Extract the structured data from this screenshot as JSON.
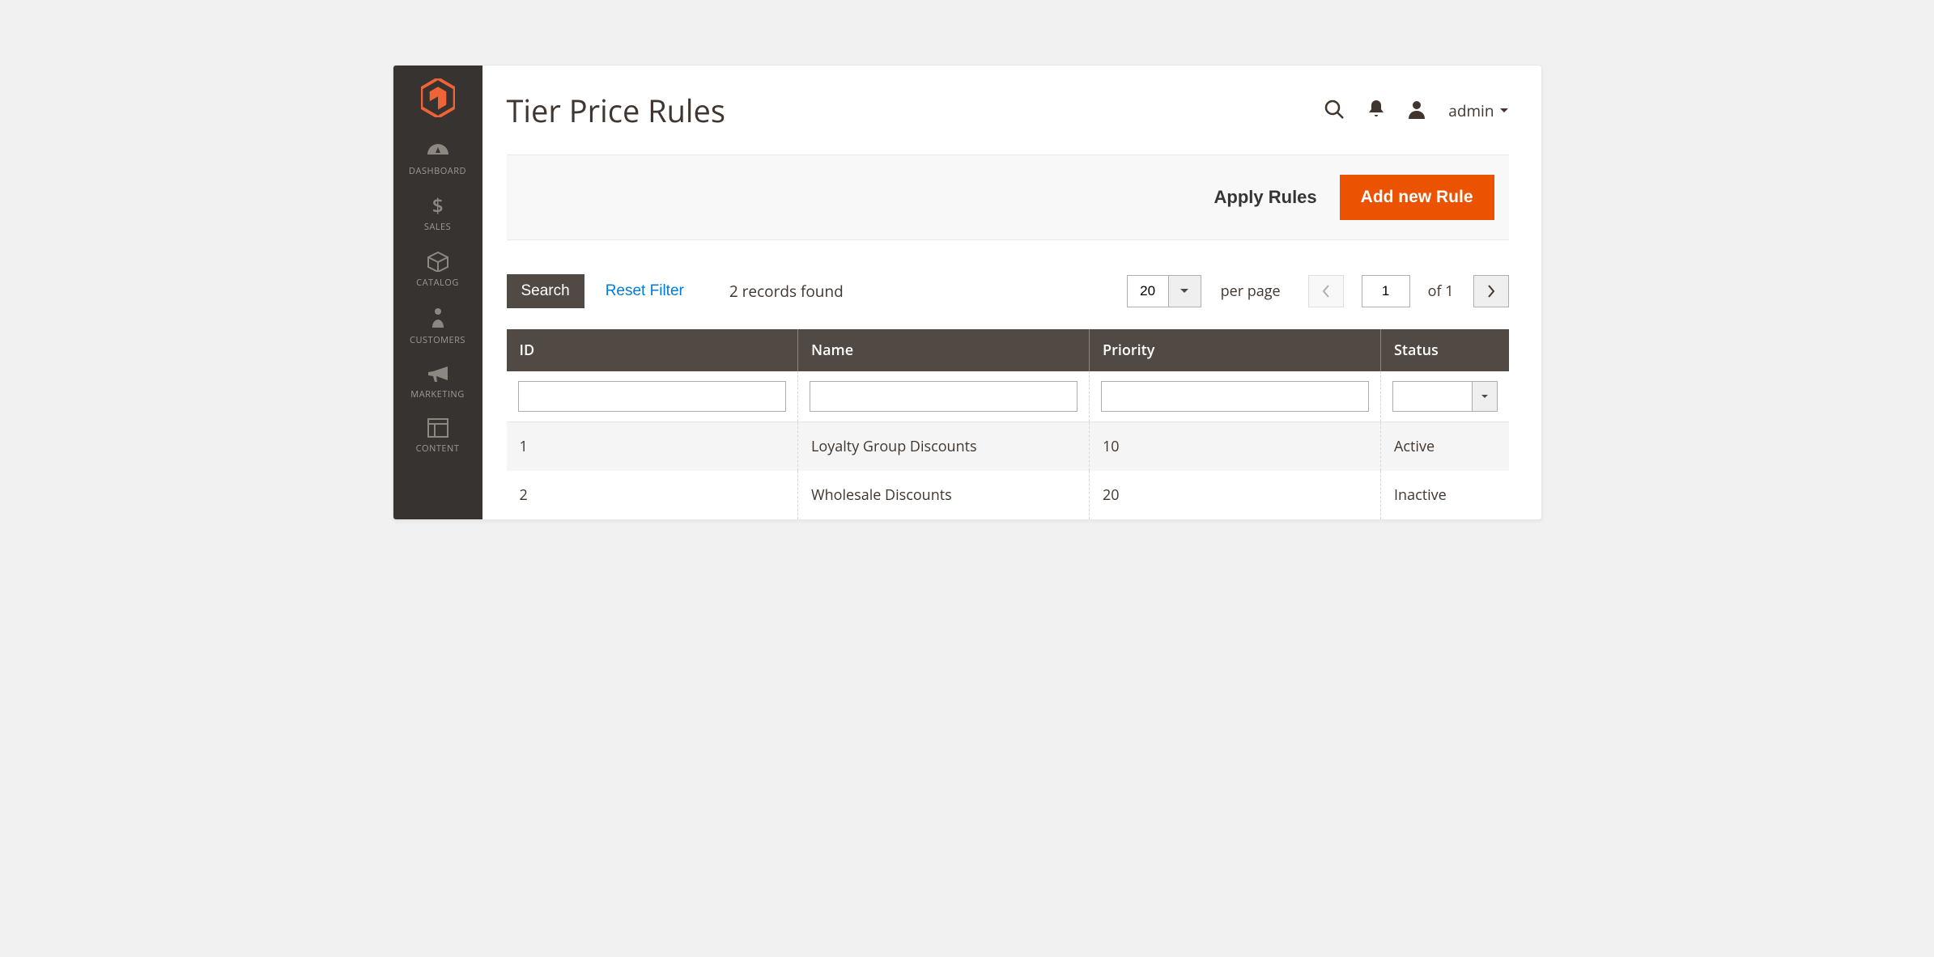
{
  "header": {
    "title": "Tier Price Rules",
    "user_label": "admin"
  },
  "sidebar": {
    "items": [
      {
        "label": "DASHBOARD"
      },
      {
        "label": "SALES"
      },
      {
        "label": "CATALOG"
      },
      {
        "label": "CUSTOMERS"
      },
      {
        "label": "MARKETING"
      },
      {
        "label": "CONTENT"
      }
    ]
  },
  "actionbar": {
    "apply_label": "Apply Rules",
    "add_label": "Add new Rule"
  },
  "toolbar": {
    "search_label": "Search",
    "reset_label": "Reset Filter",
    "records_found": "2 records found",
    "page_size": "20",
    "per_page_label": "per page",
    "current_page": "1",
    "of_label": "of 1"
  },
  "table": {
    "columns": {
      "id": "ID",
      "name": "Name",
      "priority": "Priority",
      "status": "Status"
    },
    "rows": [
      {
        "id": "1",
        "name": "Loyalty Group Discounts",
        "priority": "10",
        "status": "Active"
      },
      {
        "id": "2",
        "name": "Wholesale Discounts",
        "priority": "20",
        "status": "Inactive"
      }
    ]
  }
}
